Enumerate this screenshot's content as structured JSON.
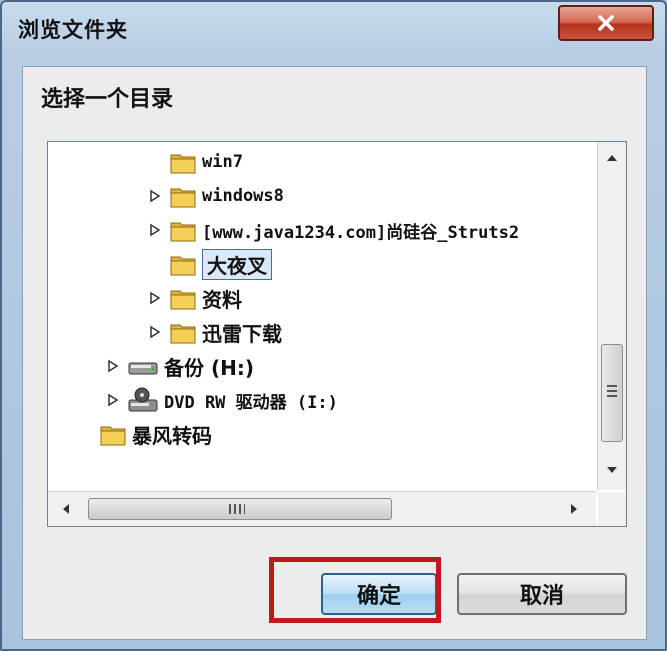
{
  "window": {
    "title": "浏览文件夹"
  },
  "dialog": {
    "prompt": "选择一个目录",
    "buttons": {
      "ok": "确定",
      "cancel": "取消"
    }
  },
  "tree": {
    "items": [
      {
        "label": "win7",
        "icon": "folder-icon",
        "expandable": false
      },
      {
        "label": "windows8",
        "icon": "folder-icon",
        "expandable": true
      },
      {
        "label": "[www.java1234.com]尚硅谷_Struts2",
        "icon": "folder-icon",
        "expandable": true
      },
      {
        "label": "大夜叉",
        "icon": "folder-icon",
        "expandable": false,
        "selected": true
      },
      {
        "label": "资料",
        "icon": "folder-icon",
        "expandable": true
      },
      {
        "label": "迅雷下载",
        "icon": "folder-icon",
        "expandable": true
      },
      {
        "label": "备份 (H:)",
        "icon": "drive-icon",
        "expandable": true
      },
      {
        "label": "DVD RW 驱动器 (I:)",
        "icon": "dvd-drive-icon",
        "expandable": true
      },
      {
        "label": "暴风转码",
        "icon": "folder-icon",
        "expandable": false
      }
    ]
  },
  "colors": {
    "highlight": "#c2171d",
    "selection": "#dbe9f7",
    "close": "#c9533c"
  }
}
